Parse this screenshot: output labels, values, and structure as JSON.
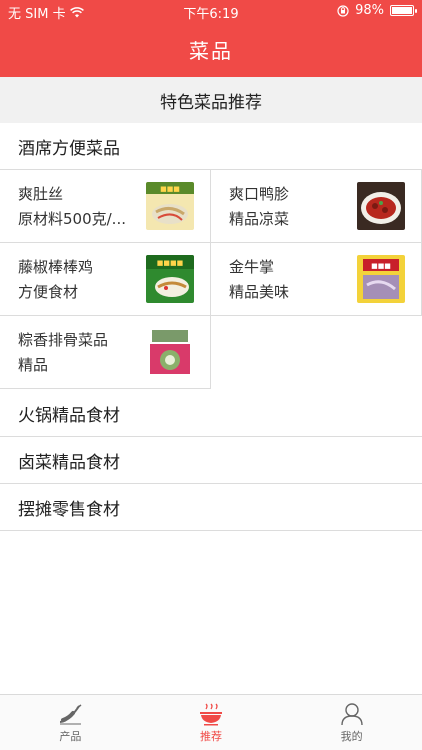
{
  "status": {
    "carrier": "无 SIM 卡",
    "time": "下午6:19",
    "battery": "98%",
    "battery_level": 0.98
  },
  "header": {
    "title": "菜品"
  },
  "featured_section": {
    "title": "特色菜品推荐"
  },
  "categories": [
    {
      "title": "酒席方便菜品",
      "items": [
        {
          "name": "爽肚丝",
          "desc": "原材料500克/...",
          "thumb_icon": "food-photo"
        },
        {
          "name": "爽口鸭胗",
          "desc": "精品凉菜",
          "thumb_icon": "food-photo"
        },
        {
          "name": "藤椒棒棒鸡",
          "desc": "方便食材",
          "thumb_icon": "food-photo"
        },
        {
          "name": "金牛掌",
          "desc": "精品美味",
          "thumb_icon": "food-photo"
        },
        {
          "name": "粽香排骨菜品",
          "desc": "精品",
          "thumb_icon": "food-photo"
        }
      ]
    },
    {
      "title": "火锅精品食材"
    },
    {
      "title": "卤菜精品食材"
    },
    {
      "title": "摆摊零售食材"
    }
  ],
  "tabs": [
    {
      "label": "产品",
      "icon": "chili-icon",
      "active": false
    },
    {
      "label": "推荐",
      "icon": "bowl-icon",
      "active": true
    },
    {
      "label": "我的",
      "icon": "person-icon",
      "active": false
    }
  ],
  "colors": {
    "accent": "#f04a47",
    "inactive": "#666666"
  }
}
